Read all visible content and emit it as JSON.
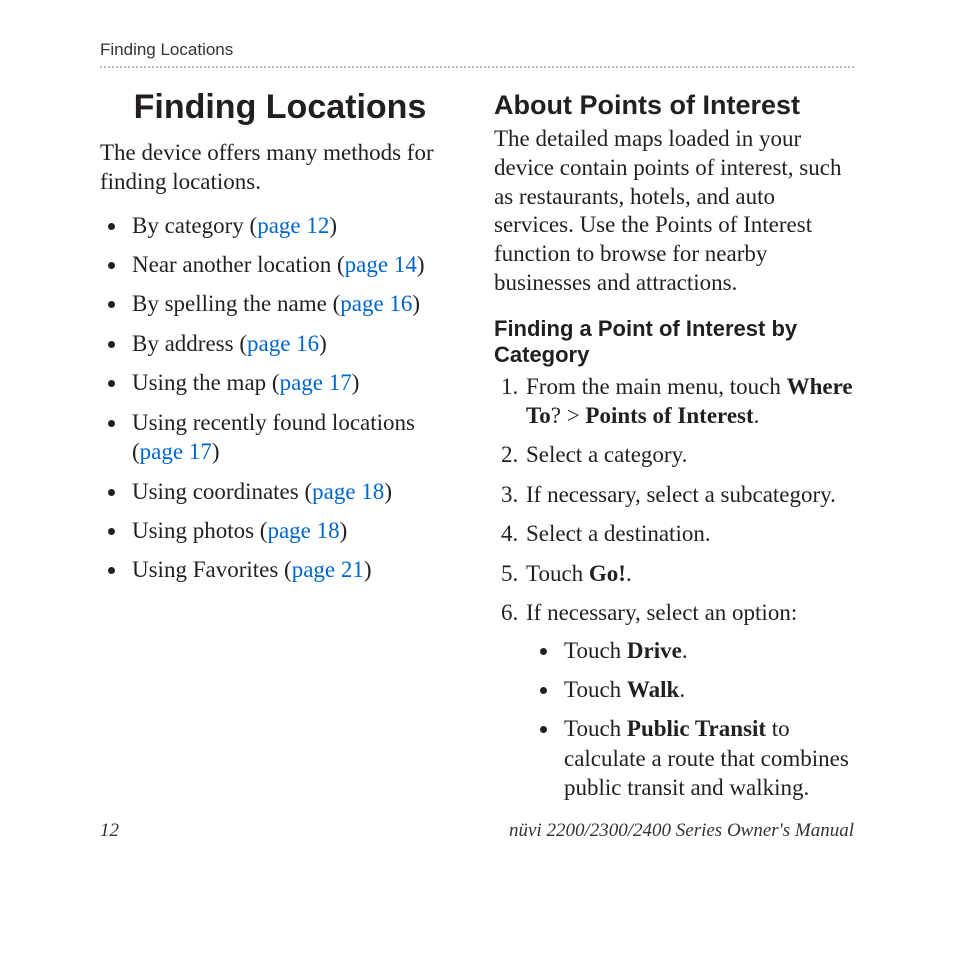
{
  "running_head": "Finding Locations",
  "left": {
    "h1": "Finding Locations",
    "intro": "The device offers many methods for finding locations.",
    "bullets": [
      {
        "pre": "By category (",
        "link": "page 12",
        "post": ")"
      },
      {
        "pre": "Near another location (",
        "link": "page 14",
        "post": ")"
      },
      {
        "pre": "By spelling the name (",
        "link": "page 16",
        "post": ")"
      },
      {
        "pre": "By address (",
        "link": "page 16",
        "post": ")"
      },
      {
        "pre": "Using the map (",
        "link": "page 17",
        "post": ")"
      },
      {
        "pre": "Using recently found locations (",
        "link": "page 17",
        "post": ")"
      },
      {
        "pre": "Using coordinates (",
        "link": "page 18",
        "post": ")"
      },
      {
        "pre": "Using photos (",
        "link": "page 18",
        "post": ")"
      },
      {
        "pre": "Using Favorites (",
        "link": "page 21",
        "post": ")"
      }
    ]
  },
  "right": {
    "h2": "About Points of Interest",
    "intro": "The detailed maps loaded in your device contain points of interest, such as restaurants, hotels, and auto services. Use the Points of Interest function to browse for nearby businesses and attractions.",
    "h3": "Finding a Point of Interest by Category",
    "step1": {
      "pre": "From the main menu, touch ",
      "b1": "Where To",
      "mid": "? > ",
      "b2": "Points of Interest",
      "post": "."
    },
    "step2": "Select a category.",
    "step3": "If necessary, select a subcategory.",
    "step4": "Select a destination.",
    "step5": {
      "pre": "Touch ",
      "b": "Go!",
      "post": "."
    },
    "step6": "If necessary, select an option:",
    "sub": {
      "a": {
        "pre": "Touch ",
        "b": "Drive",
        "post": "."
      },
      "b": {
        "pre": "Touch ",
        "b": "Walk",
        "post": "."
      },
      "c": {
        "pre": "Touch ",
        "b": "Public Transit",
        "post": " to calculate a route that combines public transit and walking."
      }
    }
  },
  "footer": {
    "page": "12",
    "manual": "nüvi 2200/2300/2400 Series Owner's Manual"
  }
}
